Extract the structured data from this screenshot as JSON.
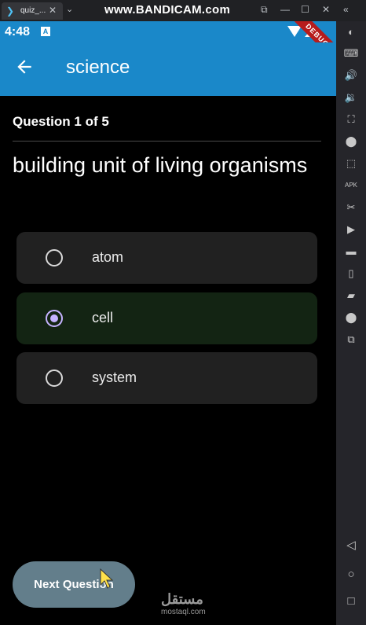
{
  "window": {
    "tab_icon": "flutter-icon",
    "tab_title": "quiz_...",
    "tab_close": "✕",
    "tab_more": "⌄",
    "watermark": "www.BANDICAM.com",
    "controls": [
      "⧉",
      "—",
      "☐",
      "✕",
      "«"
    ]
  },
  "status_bar": {
    "time": "4:48",
    "notification_icon": "A",
    "debug_label": "DEBUG"
  },
  "app_bar": {
    "title": "science"
  },
  "quiz": {
    "counter": "Question 1 of 5",
    "question": "building unit of living organisms",
    "options": [
      {
        "label": "atom",
        "selected": false
      },
      {
        "label": "cell",
        "selected": true
      },
      {
        "label": "system",
        "selected": false
      }
    ],
    "next_label": "Next Question"
  },
  "branding": {
    "logo_text": "مستقل",
    "logo_sub": "mostaql.com"
  },
  "sidebar": {
    "icons": [
      "◐",
      "⌨",
      "🔊",
      "🔉",
      "⛶",
      "⬤",
      "⬚",
      "APK",
      "✂",
      "▶",
      "▬",
      "▯",
      "▰",
      "⬤",
      "⧉"
    ],
    "nav": [
      "◁",
      "○",
      "□"
    ]
  },
  "colors": {
    "accent": "#1a88c9",
    "radio_selected": "#c5b3ff",
    "selected_card": "#132413",
    "card": "#212121",
    "button": "#637e8b"
  }
}
